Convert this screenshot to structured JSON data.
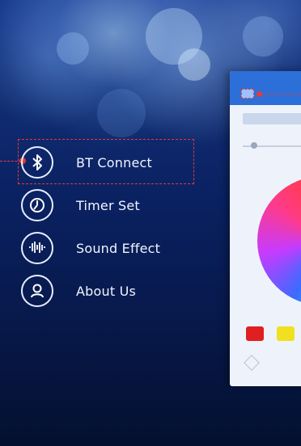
{
  "status_bar": {
    "left": "",
    "center": "",
    "right": ""
  },
  "menu": {
    "items": [
      {
        "label": "BT Connect",
        "icon": "bluetooth-icon"
      },
      {
        "label": "Timer Set",
        "icon": "timer-icon"
      },
      {
        "label": "Sound Effect",
        "icon": "sound-effect-icon"
      },
      {
        "label": "About Us",
        "icon": "about-icon"
      }
    ]
  },
  "colors": {
    "highlight": "#e23a3a",
    "preview_header": "#2d6fd8",
    "swatch_red": "#e02020",
    "swatch_yellow": "#f0e020"
  }
}
